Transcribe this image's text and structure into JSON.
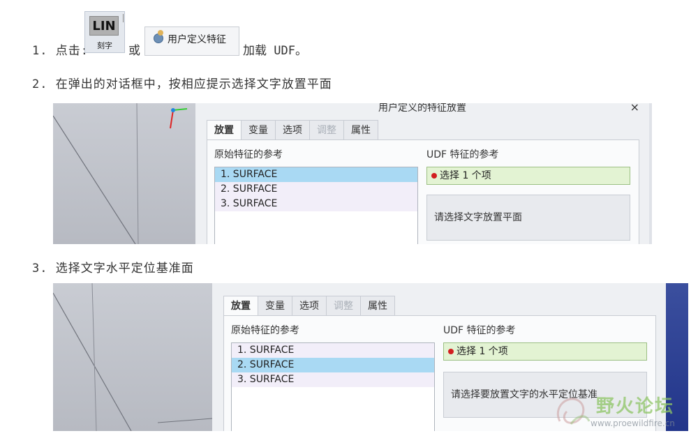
{
  "step1": {
    "prefix": "1. 点击:",
    "or": "或",
    "suffix": "加载 UDF。"
  },
  "lin_button": {
    "icon_text": "LIN",
    "label": "刻字"
  },
  "udf_button": {
    "label": "用户定义特征"
  },
  "step2": {
    "text": "2. 在弹出的对话框中，按相应提示选择文字放置平面"
  },
  "step3": {
    "text": "3. 选择文字水平定位基准面"
  },
  "dialog1": {
    "title": "用户定义的特征放置",
    "close": "×",
    "tabs": [
      {
        "label": "放置",
        "state": "active"
      },
      {
        "label": "变量",
        "state": "normal"
      },
      {
        "label": "选项",
        "state": "normal"
      },
      {
        "label": "调整",
        "state": "disabled"
      },
      {
        "label": "属性",
        "state": "normal"
      }
    ],
    "left_label": "原始特征的参考",
    "right_label": "UDF 特征的参考",
    "items": [
      "1. SURFACE",
      "2. SURFACE",
      "3. SURFACE"
    ],
    "selected_index": 0,
    "select_status": "选择 1 个项",
    "prompt": "请选择文字放置平面"
  },
  "dialog2": {
    "tabs": [
      {
        "label": "放置",
        "state": "active"
      },
      {
        "label": "变量",
        "state": "normal"
      },
      {
        "label": "选项",
        "state": "normal"
      },
      {
        "label": "调整",
        "state": "disabled"
      },
      {
        "label": "属性",
        "state": "normal"
      }
    ],
    "left_label": "原始特征的参考",
    "right_label": "UDF 特征的参考",
    "items": [
      "1. SURFACE",
      "2. SURFACE",
      "3. SURFACE"
    ],
    "selected_index": 1,
    "select_status": "选择 1 个项",
    "prompt": "请选择要放置文字的水平定位基准"
  },
  "watermark": {
    "title": "野火论坛",
    "url": "www.proewildfire.cn"
  },
  "colors": {
    "selected_row": "#a9d9f3",
    "status_green": "#e3f3d3",
    "status_dot": "#d21f1f",
    "viewport_blue": "#22358a"
  }
}
